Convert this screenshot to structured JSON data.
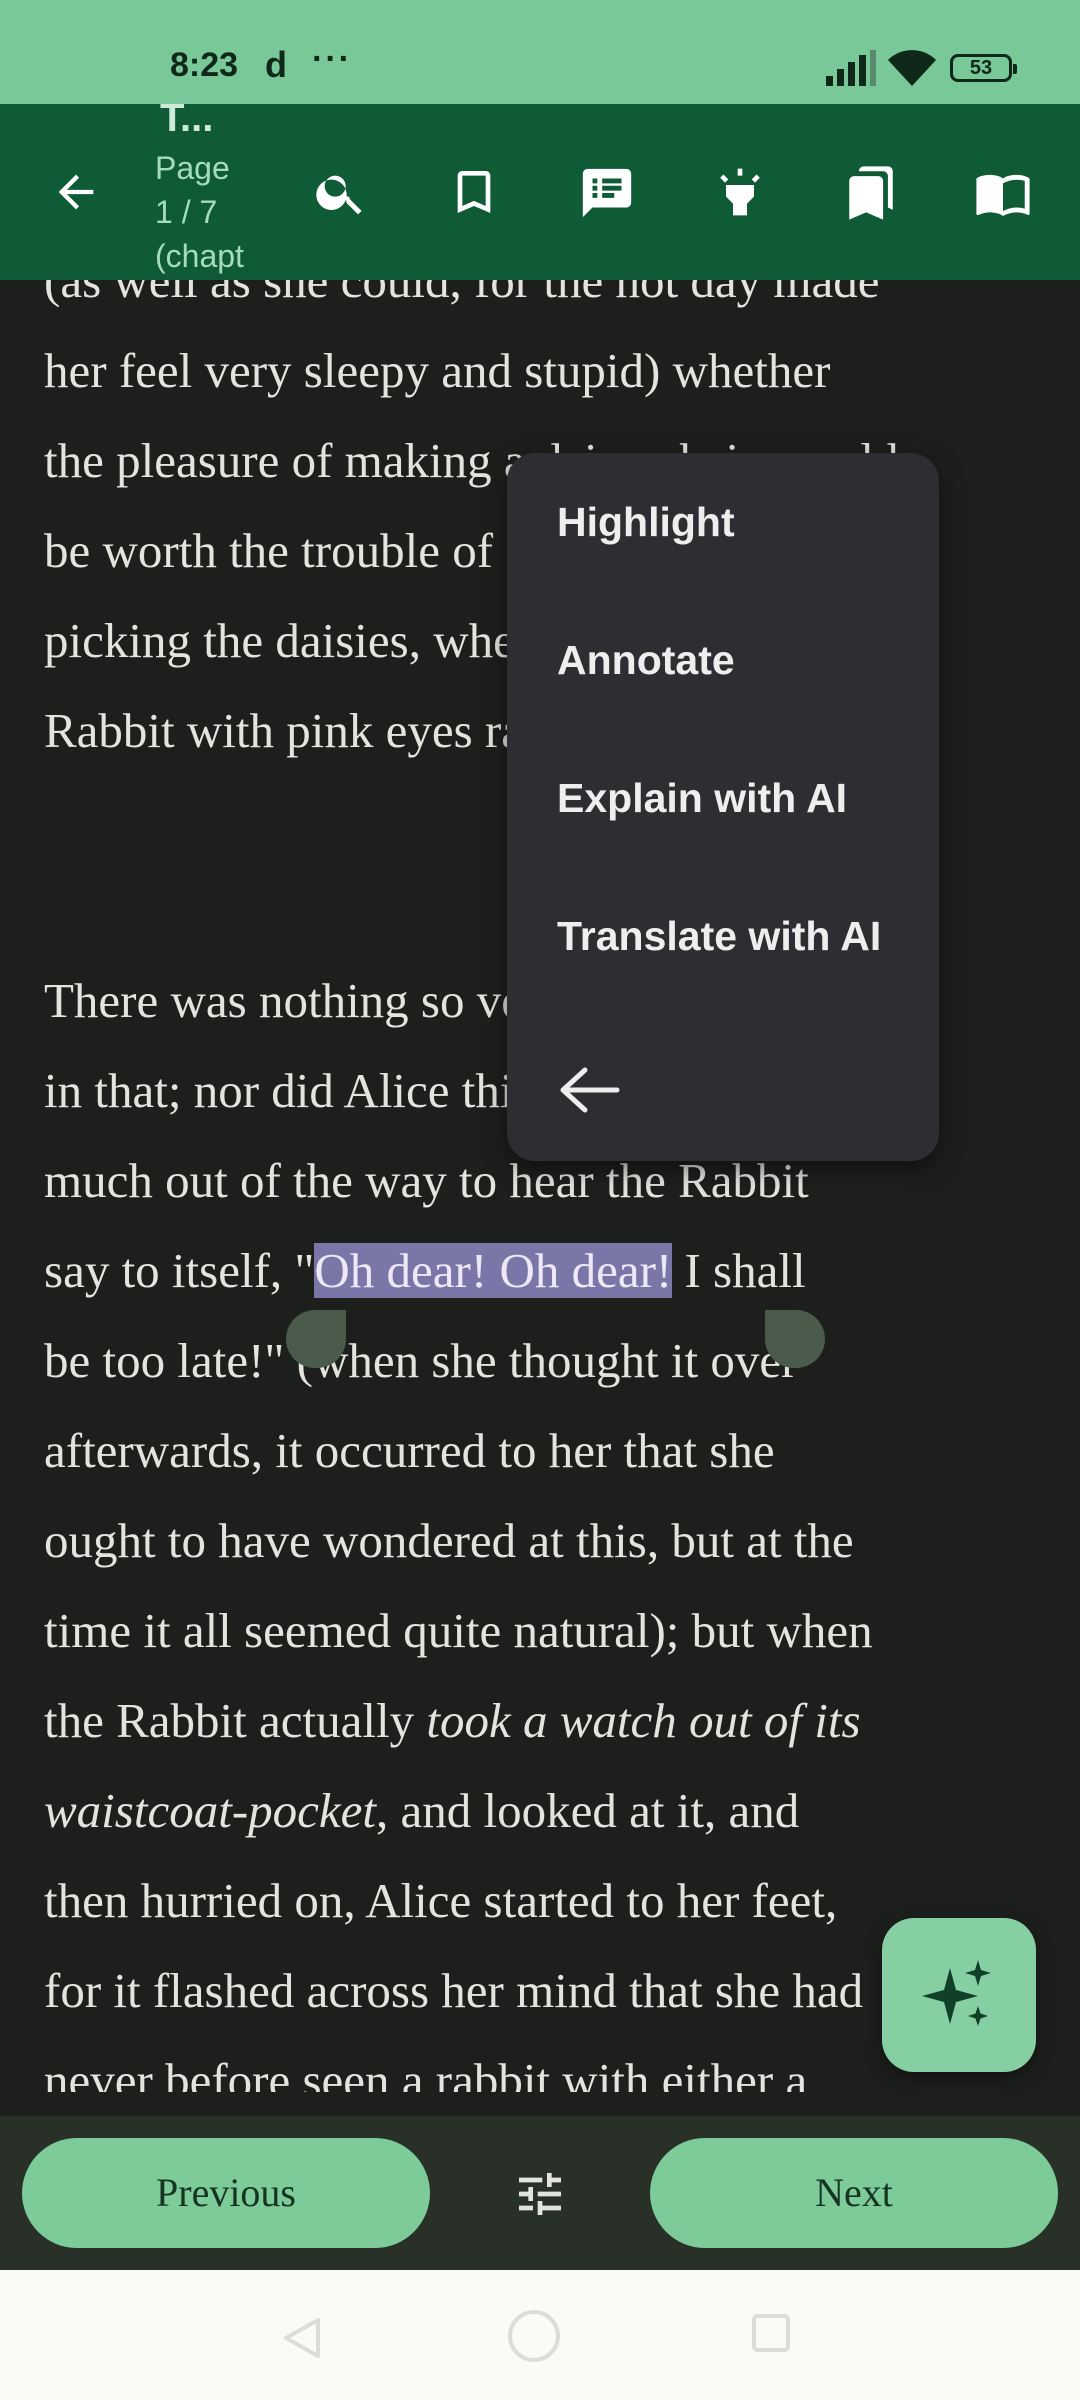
{
  "status_bar": {
    "time": "8:23",
    "app_glyph": "d",
    "more": "···",
    "battery": "53"
  },
  "toolbar": {
    "title_fragment": "T...",
    "page_lines": [
      "Page",
      "1 / 7",
      "(chapt"
    ],
    "icons": [
      "back-arrow-icon",
      "search-icon",
      "bookmark-icon",
      "annotations-icon",
      "highlight-icon",
      "bookmarks-list-icon",
      "book-open-icon"
    ]
  },
  "reader": {
    "lines": [
      "(as well as she could, for the hot day made",
      "her feel very sleepy and stupid) whether",
      "the pleasure of making a daisy-chain would",
      "be worth the trouble of getting up and",
      "picking the daisies, when suddenly a White",
      "Rabbit with pink eyes ran close by her.",
      "",
      "There was nothing so very remarkable",
      "in that; nor did Alice think it so very",
      "much out of the way to hear the Rabbit"
    ],
    "line_say_before": "say to itself, \"",
    "line_say_highlight": "Oh dear! Oh dear!",
    "line_say_after": " I shall",
    "lines_after": [
      "be too late!\" (when she thought it over",
      "afterwards, it occurred to her that she",
      "ought to have wondered at this, but at the",
      "time it all seemed quite natural); but when"
    ],
    "line_rabbit_plain": "the Rabbit actually ",
    "line_rabbit_italic": "took a watch out of its",
    "line_waist_italic": "waistcoat-pocket",
    "line_waist_plain": ", and looked at it, and",
    "lines_end": [
      "then hurried on, Alice started to her feet,",
      "for it flashed across her mind that she had",
      "never before seen a rabbit with either a"
    ]
  },
  "context_menu": {
    "items": [
      "Highlight",
      "Annotate",
      "Explain with AI",
      "Translate with AI"
    ],
    "back_icon": "arrow-left-icon"
  },
  "fab": {
    "icon": "sparkle-icon"
  },
  "bottom_nav": {
    "previous_label": "Previous",
    "next_label": "Next",
    "settings_icon": "tune-icon"
  },
  "colors": {
    "status_bar_bg": "#78c898",
    "toolbar_bg": "#0e5b36",
    "reader_bg": "#1d1f1d",
    "highlight": "#7b76a8",
    "button": "#7ccb99",
    "menu_bg": "#2e2e32"
  }
}
